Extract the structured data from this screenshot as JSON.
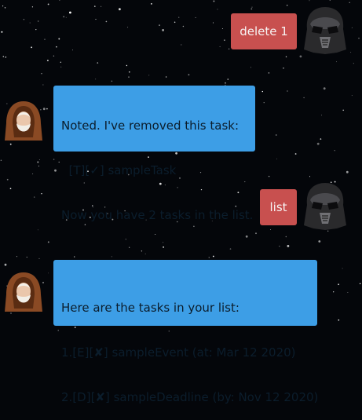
{
  "conversation": [
    {
      "sender": "user",
      "text": "delete 1",
      "avatar_icon": "vader-helmet-icon"
    },
    {
      "sender": "duke",
      "avatar_icon": "robed-jedi-icon",
      "lines": [
        "Noted. I've removed this task:",
        "  [T][✓] sampleTask",
        "Now you have 2 tasks in the list."
      ]
    },
    {
      "sender": "user",
      "text": "list",
      "avatar_icon": "vader-helmet-icon"
    },
    {
      "sender": "duke",
      "avatar_icon": "robed-jedi-icon",
      "lines": [
        "Here are the tasks in your list:",
        "1.[E][✘] sampleEvent (at: Mar 12 2020)",
        "2.[D][✘] sampleDeadline (by: Nov 12 2020)"
      ]
    }
  ],
  "colors": {
    "background": "#04060a",
    "user_bubble": "#c8504f",
    "bot_bubble": "#3d9ee6"
  }
}
